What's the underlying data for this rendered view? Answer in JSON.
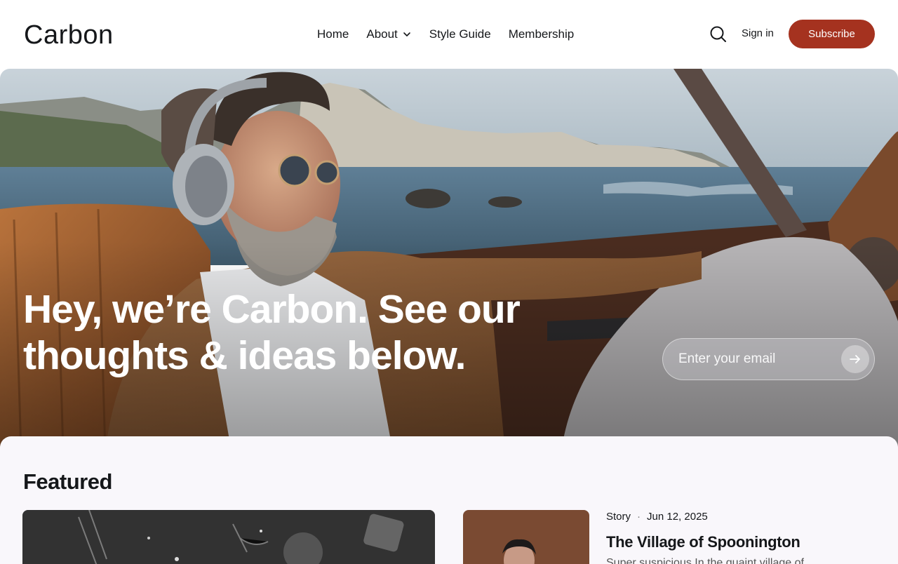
{
  "site": {
    "logo": "Carbon"
  },
  "nav": {
    "items": [
      {
        "label": "Home"
      },
      {
        "label": "About",
        "has_dropdown": true
      },
      {
        "label": "Style Guide"
      },
      {
        "label": "Membership"
      }
    ]
  },
  "header_actions": {
    "search_icon": "search-icon",
    "signin_label": "Sign in",
    "subscribe_label": "Subscribe"
  },
  "hero": {
    "title": "Hey, we’re Carbon. See our thoughts & ideas below.",
    "email_placeholder": "Enter your email",
    "submit_icon": "arrow-right-icon"
  },
  "featured": {
    "heading": "Featured",
    "posts": [
      {
        "tag": "Story",
        "separator": "·",
        "date": "Jun 12, 2025",
        "title": "The Village of Spoonington",
        "excerpt": "Super suspicious In the quaint village of"
      }
    ]
  },
  "colors": {
    "accent": "#a5321f",
    "text": "#15171a",
    "featured_bg": "#f9f7fb"
  }
}
